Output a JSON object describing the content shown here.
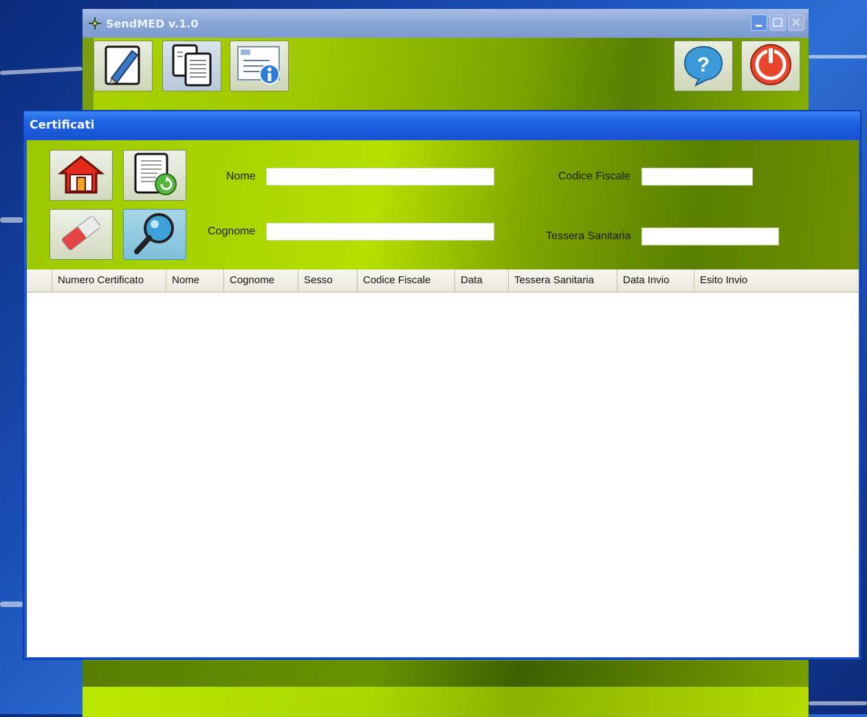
{
  "main_window": {
    "title": "SendMED v.1.0",
    "toolbar": [
      {
        "name": "edit",
        "icon": "pencil-document-icon"
      },
      {
        "name": "copy",
        "icon": "documents-icon"
      },
      {
        "name": "info",
        "icon": "info-form-icon"
      },
      {
        "name": "help",
        "icon": "help-bubble-icon"
      },
      {
        "name": "exit",
        "icon": "power-icon"
      }
    ]
  },
  "certificati_window": {
    "title": "Certificati",
    "buttons": [
      {
        "name": "home",
        "icon": "home-icon"
      },
      {
        "name": "refresh-doc",
        "icon": "document-refresh-icon"
      },
      {
        "name": "clear",
        "icon": "eraser-icon"
      },
      {
        "name": "search",
        "icon": "magnifier-icon"
      }
    ],
    "fields": {
      "nome": {
        "label": "Nome",
        "value": ""
      },
      "cognome": {
        "label": "Cognome",
        "value": ""
      },
      "codice_fiscale": {
        "label": "Codice Fiscale",
        "value": ""
      },
      "tessera_sanitaria": {
        "label": "Tessera Sanitaria",
        "value": ""
      }
    },
    "grid": {
      "columns": [
        "Numero Certificato",
        "Nome",
        "Cognome",
        "Sesso",
        "Codice Fiscale",
        "Data",
        "Tessera Sanitaria",
        "Data Invio",
        "Esito Invio"
      ],
      "rows": []
    }
  },
  "colors": {
    "accent_green": "#9fc900",
    "title_blue": "#1d63e3"
  }
}
